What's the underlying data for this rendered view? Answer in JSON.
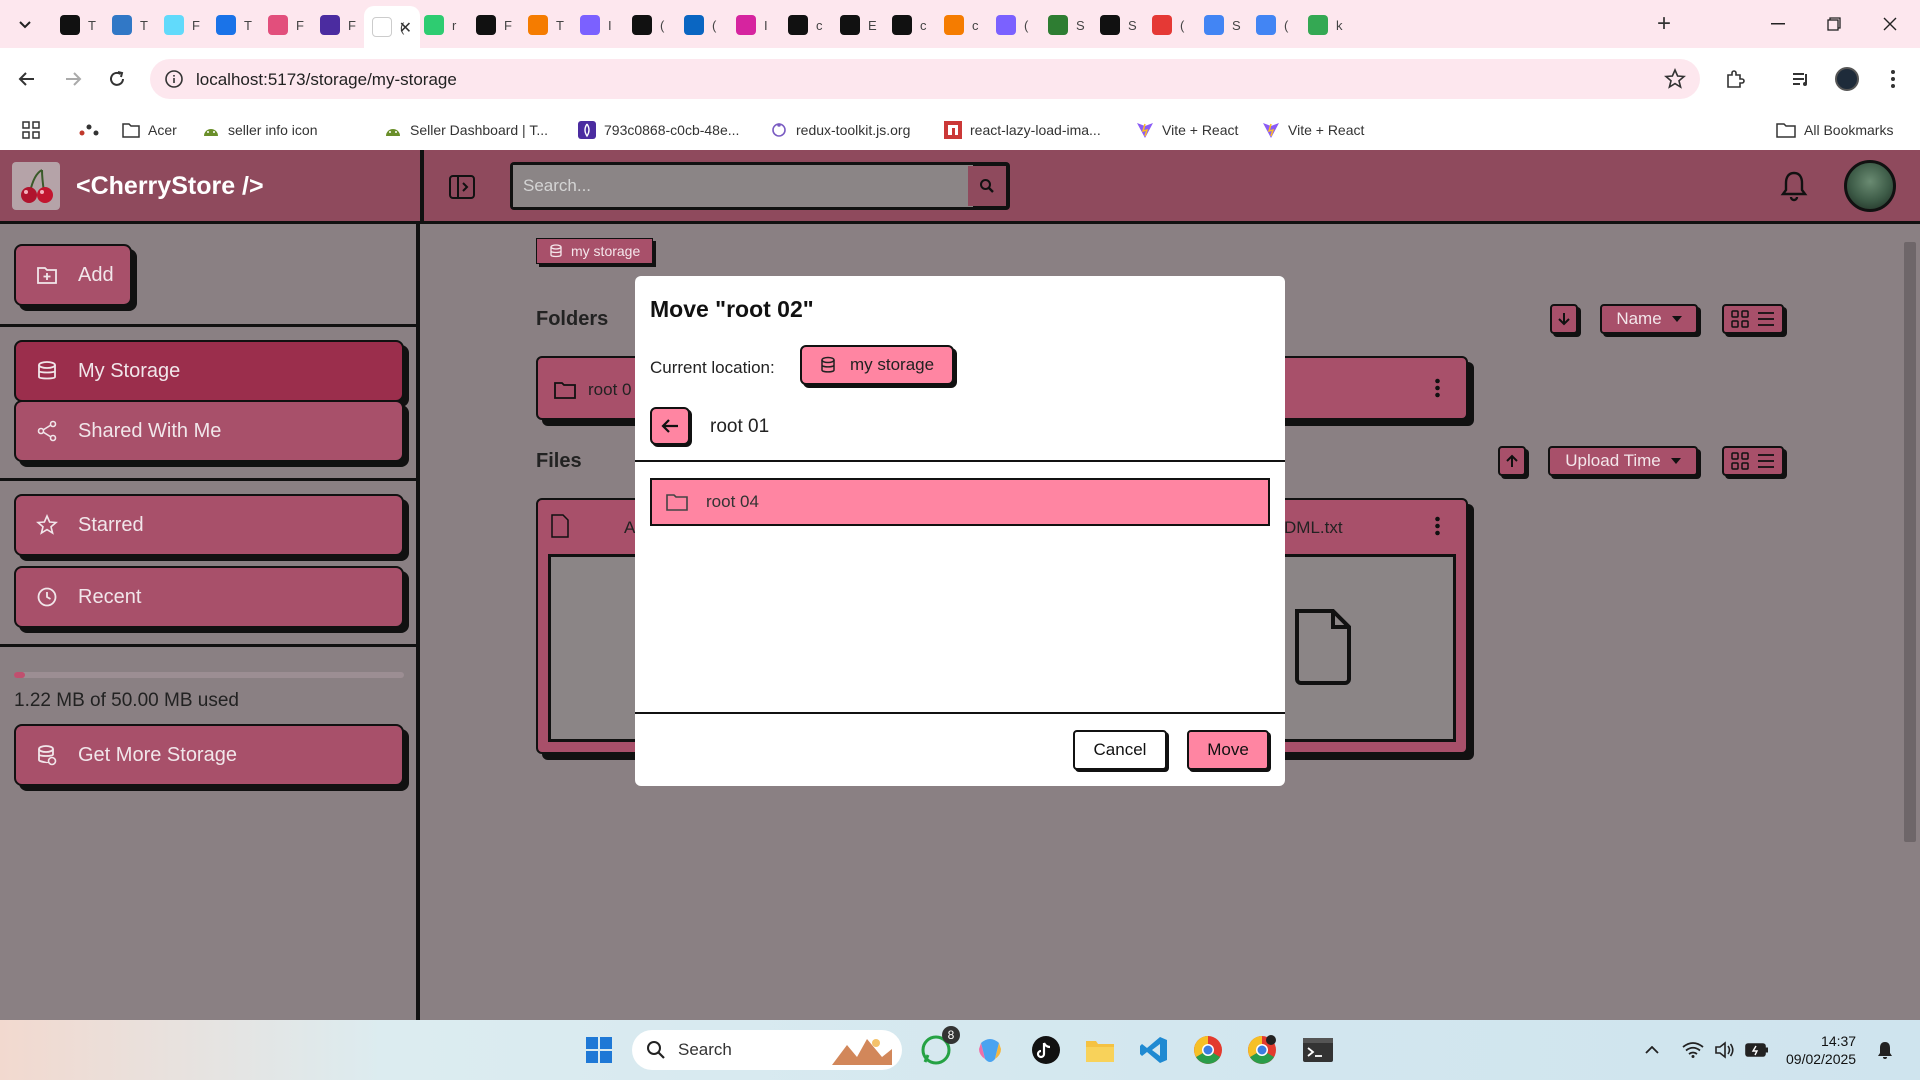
{
  "browser": {
    "url": "localhost:5173/storage/my-storage",
    "tabs": [
      {
        "letter": "T",
        "color": "#111111"
      },
      {
        "letter": "T",
        "color": "#3178c6"
      },
      {
        "letter": "F",
        "color": "#61dafb"
      },
      {
        "letter": "T",
        "color": "#1a73e8"
      },
      {
        "letter": "F",
        "color": "#e24f7c"
      },
      {
        "letter": "F",
        "color": "#4b2ca0"
      },
      {
        "letter": "(",
        "color": "#ffffff"
      },
      {
        "letter": "r",
        "color": "#2ecc71"
      },
      {
        "letter": "F",
        "color": "#111111"
      },
      {
        "letter": "T",
        "color": "#f57c00"
      },
      {
        "letter": "I",
        "color": "#7b61ff"
      },
      {
        "letter": "(",
        "color": "#111111"
      },
      {
        "letter": "(",
        "color": "#0a66c2"
      },
      {
        "letter": "I",
        "color": "#d6249f"
      },
      {
        "letter": "c",
        "color": "#111111"
      },
      {
        "letter": "E",
        "color": "#111111"
      },
      {
        "letter": "c",
        "color": "#111111"
      },
      {
        "letter": "c",
        "color": "#f57c00"
      },
      {
        "letter": "(",
        "color": "#7b61ff"
      },
      {
        "letter": "S",
        "color": "#2e7d32"
      },
      {
        "letter": "S",
        "color": "#111111"
      },
      {
        "letter": "(",
        "color": "#e53935"
      },
      {
        "letter": "S",
        "color": "#4285f4"
      },
      {
        "letter": "(",
        "color": "#4285f4"
      },
      {
        "letter": "k",
        "color": "#34a853"
      }
    ],
    "bookmarks": [
      {
        "label": "Acer",
        "icon": "folder-icon"
      },
      {
        "label": "seller info icon",
        "icon": "android-icon"
      },
      {
        "label": "Seller Dashboard | T...",
        "icon": "android-icon"
      },
      {
        "label": "793c0868-c0cb-48e...",
        "icon": "purple-app-icon"
      },
      {
        "label": "redux-toolkit.js.org",
        "icon": "redux-icon"
      },
      {
        "label": "react-lazy-load-ima...",
        "icon": "npm-icon"
      },
      {
        "label": "Vite + React",
        "icon": "vite-icon"
      },
      {
        "label": "Vite + React",
        "icon": "vite-icon"
      }
    ],
    "all_bookmarks": "All Bookmarks"
  },
  "app": {
    "brand": "<CherryStore />",
    "search_placeholder": "Search...",
    "sidebar": {
      "add": "Add",
      "my_storage": "My Storage",
      "shared": "Shared With Me",
      "starred": "Starred",
      "recent": "Recent",
      "usage_text": "1.22 MB of 50.00 MB used",
      "usage_fraction": 0.0244,
      "get_more": "Get More Storage"
    },
    "breadcrumb": "my storage",
    "folders_title": "Folders",
    "files_title": "Files",
    "folder_card_label": "root 0",
    "file_card_label_left": "A",
    "file_card_label_right": "DML.txt",
    "folder_sort": "Name",
    "file_sort": "Upload Time"
  },
  "modal": {
    "title": "Move \"root 02\"",
    "current_location_label": "Current location:",
    "location_chip": "my storage",
    "current_folder": "root 01",
    "folders": [
      "root 04"
    ],
    "cancel": "Cancel",
    "move": "Move"
  },
  "taskbar": {
    "search": "Search",
    "whatsapp_badge": "8",
    "time": "14:37",
    "date": "09/02/2025"
  },
  "colors": {
    "accent": "#a8506a",
    "accent_dark": "#9b2e4c",
    "pink": "#ff85a2",
    "topbar": "#8f4a5d"
  }
}
